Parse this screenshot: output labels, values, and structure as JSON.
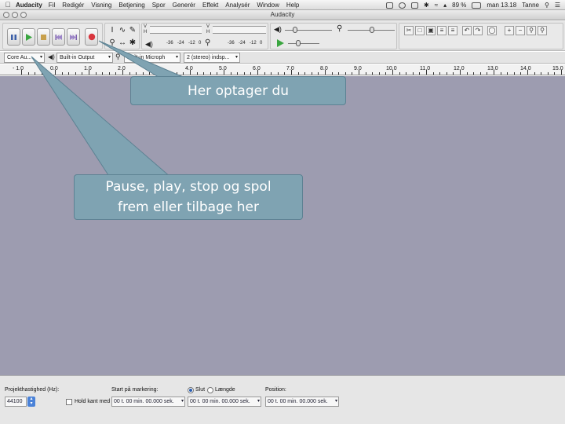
{
  "menubar": {
    "app_name": "Audacity",
    "items": [
      "Fil",
      "Redigér",
      "Visning",
      "Betjening",
      "Spor",
      "Generér",
      "Effekt",
      "Analysér",
      "Window",
      "Help"
    ],
    "battery": "89 %",
    "clock": "man 13.18",
    "user": "Tanne"
  },
  "window": {
    "title": "Audacity"
  },
  "meters": {
    "record_ticks": [
      "-36",
      "-24",
      "-12",
      "0"
    ],
    "play_ticks": [
      "-36",
      "-24",
      "-12",
      "0"
    ],
    "channel_top": "V",
    "channel_bottom": "H"
  },
  "devices": {
    "host": "Core Au...",
    "output": "Built-in Output",
    "input": "Built-in Microph",
    "channels": "2 (stereo) indsp..."
  },
  "ruler": {
    "ticks": [
      "- 1.0",
      "0.0",
      "1.0",
      "2.0",
      "3.0",
      "4.0",
      "5.0",
      "6.0",
      "7.0",
      "8.0",
      "9.0",
      "10.0",
      "11.0",
      "12.0",
      "13.0",
      "14.0",
      "15.0"
    ]
  },
  "selection_bar": {
    "rate_label": "Projekthastighed (Hz):",
    "rate_value": "44100",
    "snap_label": "Hold kant med",
    "start_label": "Start på markering:",
    "end_option": "Slut",
    "length_option": "Længde",
    "position_label": "Position:",
    "time_start": "00 t. 00 min. 00.000 sek.",
    "time_end": "00 t. 00 min. 00.000 sek.",
    "time_position": "00 t. 00 min. 00.000 sek."
  },
  "callouts": {
    "record": "Her optager du",
    "transport_line1": "Pause, play, stop og spol",
    "transport_line2": "frem eller tilbage her"
  },
  "colors": {
    "track_background": "#9d9cb0",
    "callout_fill": "#7fa3b2",
    "record_red": "#d9363e",
    "play_green": "#3aa640"
  },
  "icons": [
    "apple-icon",
    "pause-icon",
    "play-icon",
    "stop-icon",
    "skip-back-icon",
    "skip-forward-icon",
    "record-icon",
    "selection-tool-icon",
    "envelope-tool-icon",
    "draw-tool-icon",
    "zoom-tool-icon",
    "timeshift-tool-icon",
    "multi-tool-icon",
    "speaker-icon",
    "microphone-icon",
    "wifi-icon",
    "battery-icon",
    "search-icon"
  ]
}
